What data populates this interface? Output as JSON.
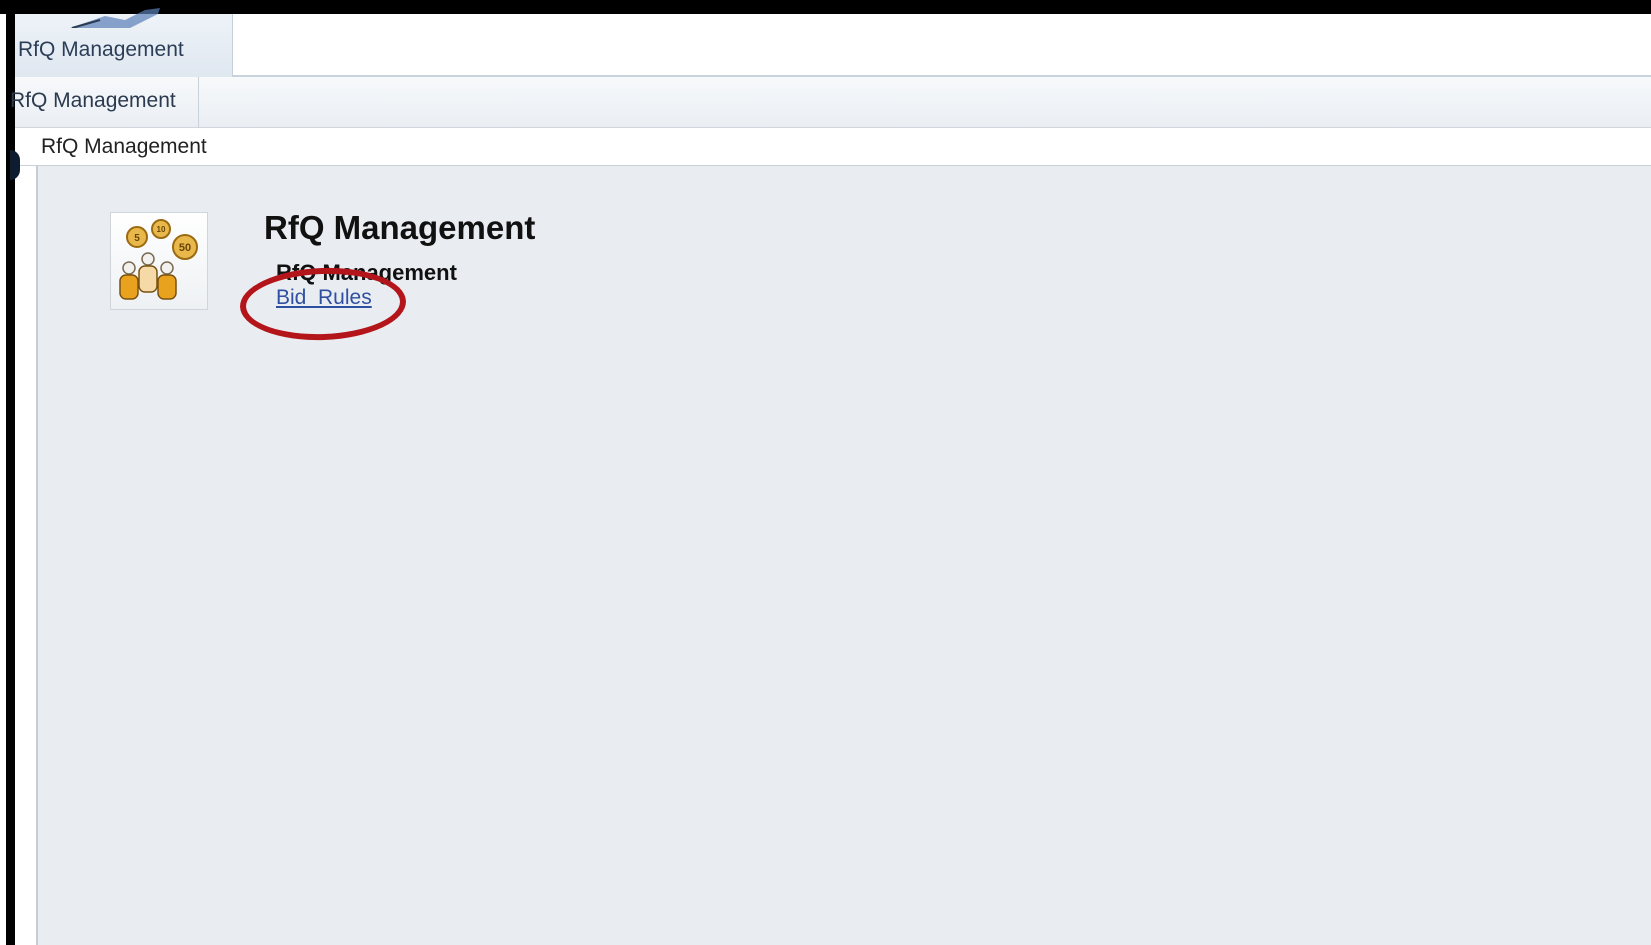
{
  "top_tab": {
    "label": "RfQ Management"
  },
  "subnav": {
    "item_label": "RfQ Management"
  },
  "breadcrumb": {
    "label": "RfQ Management"
  },
  "main": {
    "title": "RfQ Management",
    "section_title": "RfQ Management",
    "links": [
      {
        "label": "Bid  Rules"
      }
    ]
  },
  "app_tile": {
    "icon": "rfq-bidders-coins-icon",
    "coins": [
      "5",
      "10",
      "50"
    ]
  },
  "colors": {
    "link": "#2f4fa0",
    "highlight": "#b3151a",
    "content_bg": "#e9edf1"
  }
}
